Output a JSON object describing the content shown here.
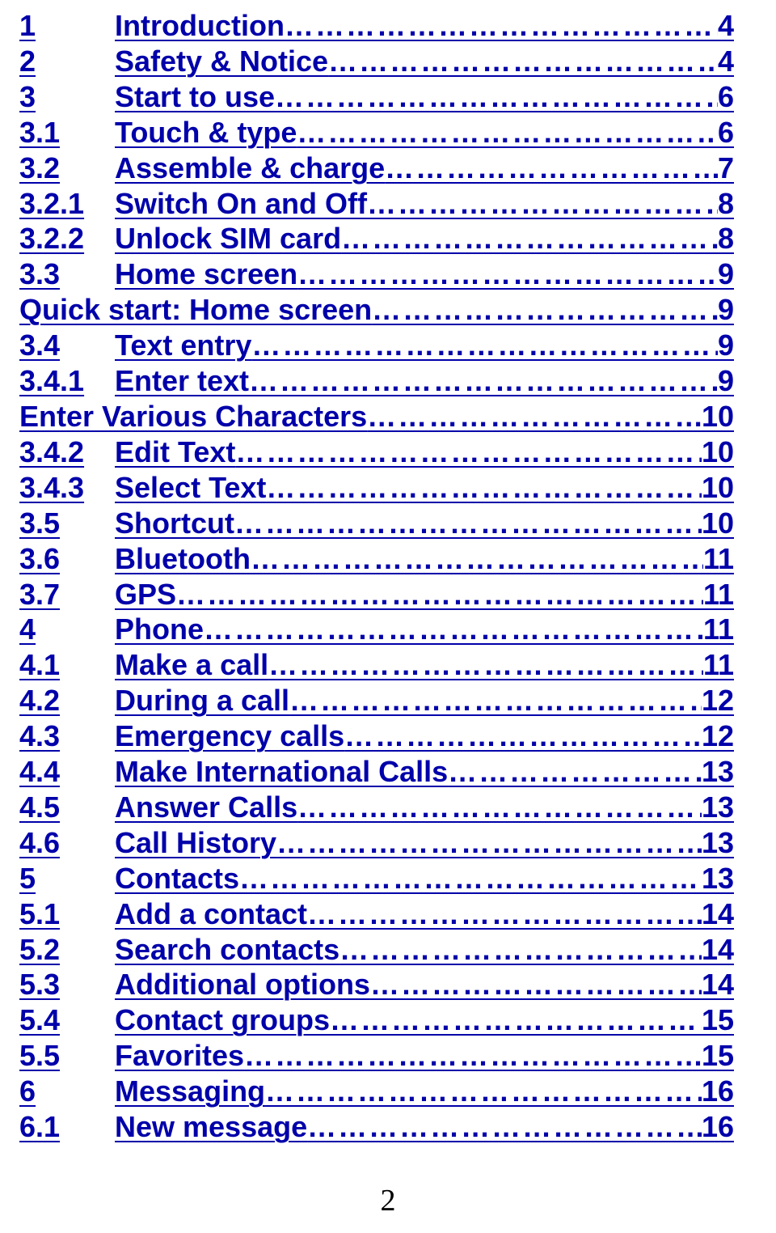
{
  "toc": [
    {
      "number": "1",
      "title": "Introduction",
      "page": "4",
      "hasNumber": true
    },
    {
      "number": "2",
      "title": "Safety & Notice",
      "page": "4",
      "hasNumber": true
    },
    {
      "number": "3",
      "title": "Start to use",
      "page": "6",
      "hasNumber": true
    },
    {
      "number": "3.1",
      "title": "Touch & type",
      "page": "6",
      "hasNumber": true
    },
    {
      "number": "3.2",
      "title": "Assemble & charge",
      "page": "7",
      "hasNumber": true
    },
    {
      "number": "3.2.1",
      "title": "Switch On and Off",
      "page": "8",
      "hasNumber": true
    },
    {
      "number": "3.2.2",
      "title": "Unlock SIM card",
      "page": "8",
      "hasNumber": true
    },
    {
      "number": "3.3",
      "title": "Home screen",
      "page": "9",
      "hasNumber": true
    },
    {
      "number": "",
      "title": "Quick start: Home screen",
      "page": "9",
      "hasNumber": false
    },
    {
      "number": "3.4",
      "title": "Text entry",
      "page": "9",
      "hasNumber": true
    },
    {
      "number": "3.4.1",
      "title": "Enter text",
      "page": "9",
      "hasNumber": true
    },
    {
      "number": "",
      "title": "Enter Various Characters",
      "page": "10",
      "hasNumber": false
    },
    {
      "number": "3.4.2",
      "title": "Edit Text",
      "page": "10",
      "hasNumber": true
    },
    {
      "number": "3.4.3",
      "title": "Select Text",
      "page": "10",
      "hasNumber": true
    },
    {
      "number": "3.5",
      "title": "Shortcut",
      "page": "10",
      "hasNumber": true
    },
    {
      "number": "3.6",
      "title": "Bluetooth",
      "page": "11",
      "hasNumber": true
    },
    {
      "number": "3.7",
      "title": "GPS",
      "page": "11",
      "hasNumber": true
    },
    {
      "number": "4",
      "title": "Phone",
      "page": "11",
      "hasNumber": true
    },
    {
      "number": "4.1",
      "title": "Make a call",
      "page": "11",
      "hasNumber": true
    },
    {
      "number": "4.2",
      "title": "During a call",
      "page": "12",
      "hasNumber": true
    },
    {
      "number": "4.3",
      "title": "Emergency calls",
      "page": "12",
      "hasNumber": true
    },
    {
      "number": "4.4",
      "title": "Make International Calls",
      "page": "13",
      "hasNumber": true
    },
    {
      "number": "4.5",
      "title": "Answer Calls",
      "page": "13",
      "hasNumber": true
    },
    {
      "number": "4.6",
      "title": "Call History",
      "page": "13",
      "hasNumber": true
    },
    {
      "number": "5",
      "title": "Contacts",
      "page": "13",
      "hasNumber": true
    },
    {
      "number": "5.1",
      "title": "Add a contact",
      "page": "14",
      "hasNumber": true
    },
    {
      "number": "5.2",
      "title": "Search contacts",
      "page": "14",
      "hasNumber": true
    },
    {
      "number": "5.3",
      "title": "Additional options",
      "page": "14",
      "hasNumber": true
    },
    {
      "number": "5.4",
      "title": "Contact groups",
      "page": "15",
      "hasNumber": true
    },
    {
      "number": "5.5",
      "title": "Favorites",
      "page": "15",
      "hasNumber": true
    },
    {
      "number": "6",
      "title": "Messaging",
      "page": "16",
      "hasNumber": true
    },
    {
      "number": "6.1",
      "title": "New message",
      "page": "16",
      "hasNumber": true
    }
  ],
  "pageNumber": "2",
  "dotFill": "…………………………………………………………………………………………………………"
}
